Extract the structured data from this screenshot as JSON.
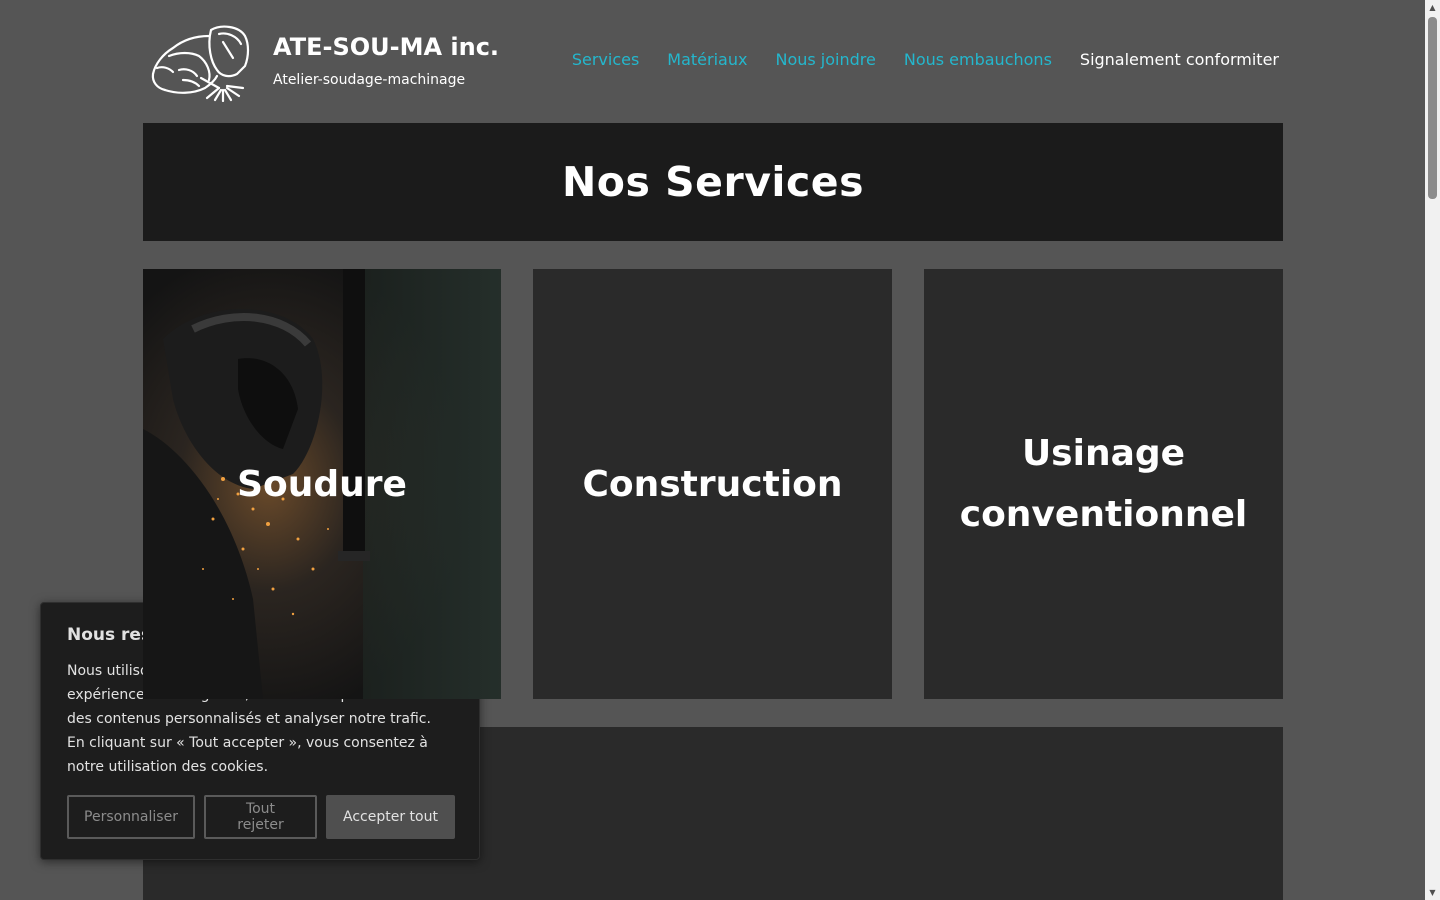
{
  "header": {
    "site_title": "ATE-SOU-MA inc.",
    "tagline": "Atelier-soudage-machinage",
    "nav": [
      {
        "label": "Services"
      },
      {
        "label": "Matériaux"
      },
      {
        "label": "Nous joindre"
      },
      {
        "label": "Nous embauchons"
      },
      {
        "label": "Signalement conformiter"
      }
    ]
  },
  "page": {
    "heading": "Nos Services"
  },
  "services": [
    {
      "title": "Soudure",
      "image": "welder-photo"
    },
    {
      "title": "Construction"
    },
    {
      "title": "Usinage conventionnel"
    }
  ],
  "cookie_banner": {
    "title": "Nous respectons votre vie privée.",
    "text": "Nous utilisons des cookies pour améliorer votre expérience de navigation, diffuser des publicités ou des contenus personnalisés et analyser notre trafic. En cliquant sur « Tout accepter », vous consentez à notre utilisation des cookies.",
    "customize_label": "Personnaliser",
    "reject_label": "Tout rejeter",
    "accept_label": "Accepter tout"
  },
  "colors": {
    "background": "#555555",
    "banner": "#1b1b1b",
    "card": "#2a2a2a",
    "nav_link": "#24b7cd",
    "nav_current": "#ffffff"
  }
}
